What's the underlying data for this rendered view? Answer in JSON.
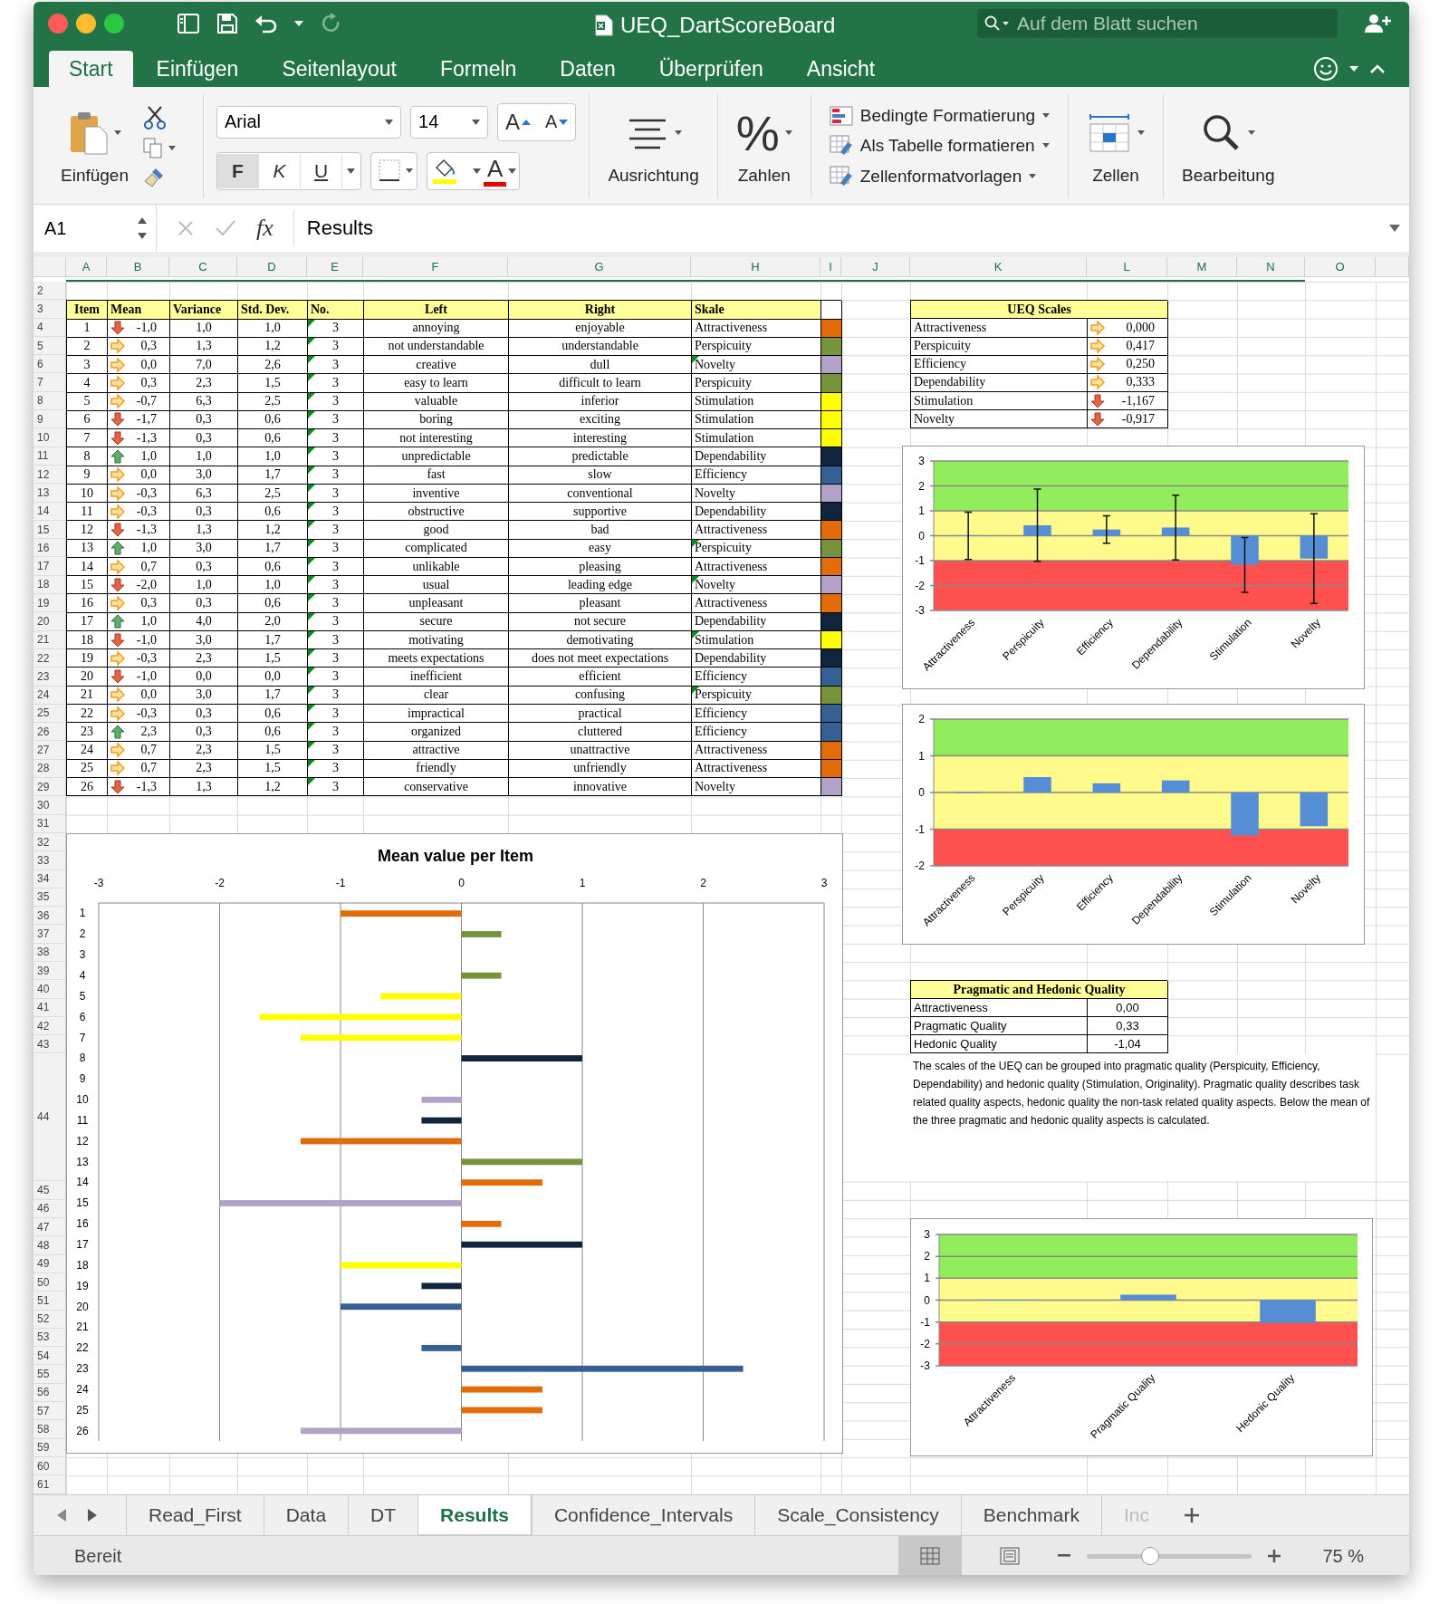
{
  "window": {
    "title": "UEQ_DartScoreBoard"
  },
  "search": {
    "placeholder": "Auf dem Blatt suchen"
  },
  "ribbon_tabs": [
    {
      "label": "Start",
      "selected": true
    },
    {
      "label": "Einfügen",
      "selected": false
    },
    {
      "label": "Seitenlayout",
      "selected": false
    },
    {
      "label": "Formeln",
      "selected": false
    },
    {
      "label": "Daten",
      "selected": false
    },
    {
      "label": "Überprüfen",
      "selected": false
    },
    {
      "label": "Ansicht",
      "selected": false
    }
  ],
  "ribbon": {
    "paste": "Einfügen",
    "font_name": "Arial",
    "font_size": "14",
    "grow_font": "A",
    "shrink_font": "A",
    "bold": "F",
    "italic": "K",
    "underline": "U",
    "font_color": "A",
    "alignment": "Ausrichtung",
    "percent": "%",
    "number": "Zahlen",
    "styles": [
      "Bedingte Formatierung",
      "Als Tabelle formatieren",
      "Zellenformatvorlagen"
    ],
    "cells": "Zellen",
    "editing": "Bearbeitung"
  },
  "formula_bar": {
    "name_box": "A1",
    "fx": "fx",
    "value": "Results"
  },
  "columns": [
    "A",
    "B",
    "C",
    "D",
    "E",
    "F",
    "G",
    "H",
    "I",
    "J",
    "K",
    "L",
    "M",
    "N",
    "O"
  ],
  "rows": [
    "2",
    "3",
    "4",
    "5",
    "6",
    "7",
    "8",
    "9",
    "10",
    "11",
    "12",
    "13",
    "14",
    "15",
    "16",
    "17",
    "18",
    "19",
    "20",
    "21",
    "22",
    "23",
    "24",
    "25",
    "26",
    "27",
    "28",
    "29",
    "30",
    "31",
    "32",
    "33",
    "34",
    "35",
    "36",
    "37",
    "38",
    "39",
    "40",
    "41",
    "42",
    "43",
    "44",
    "45",
    "46",
    "47",
    "48",
    "49",
    "50",
    "51",
    "52",
    "53",
    "54",
    "55",
    "56",
    "57",
    "58",
    "59",
    "60",
    "61"
  ],
  "item_table": {
    "headers": [
      "Item",
      "Mean",
      "Variance",
      "Std. Dev.",
      "No.",
      "Left",
      "Right",
      "Skale"
    ],
    "no_flagged": true,
    "rows": [
      {
        "item": "1",
        "kind": "down",
        "mean": "-1,0",
        "variance": "1,0",
        "std_dev": "1,0",
        "no": "3",
        "left": "annoying",
        "right": "enjoyable",
        "scale": "Attractiveness",
        "scale_flagged": false,
        "color": "#e36c0a"
      },
      {
        "item": "2",
        "kind": "right",
        "mean": "0,3",
        "variance": "1,3",
        "std_dev": "1,2",
        "no": "3",
        "left": "not understandable",
        "right": "understandable",
        "scale": "Perspicuity",
        "scale_flagged": false,
        "color": "#77933c"
      },
      {
        "item": "3",
        "kind": "right",
        "mean": "0,0",
        "variance": "7,0",
        "std_dev": "2,6",
        "no": "3",
        "left": "creative",
        "right": "dull",
        "scale": "Novelty",
        "scale_flagged": true,
        "color": "#b3a2c7"
      },
      {
        "item": "4",
        "kind": "right",
        "mean": "0,3",
        "variance": "2,3",
        "std_dev": "1,5",
        "no": "3",
        "left": "easy to learn",
        "right": "difficult to learn",
        "scale": "Perspicuity",
        "scale_flagged": false,
        "color": "#77933c"
      },
      {
        "item": "5",
        "kind": "right",
        "mean": "-0,7",
        "variance": "6,3",
        "std_dev": "2,5",
        "no": "3",
        "left": "valuable",
        "right": "inferior",
        "scale": "Stimulation",
        "scale_flagged": false,
        "color": "#ffff00"
      },
      {
        "item": "6",
        "kind": "down",
        "mean": "-1,7",
        "variance": "0,3",
        "std_dev": "0,6",
        "no": "3",
        "left": "boring",
        "right": "exciting",
        "scale": "Stimulation",
        "scale_flagged": false,
        "color": "#ffff00"
      },
      {
        "item": "7",
        "kind": "down",
        "mean": "-1,3",
        "variance": "0,3",
        "std_dev": "0,6",
        "no": "3",
        "left": "not interesting",
        "right": "interesting",
        "scale": "Stimulation",
        "scale_flagged": false,
        "color": "#ffff00"
      },
      {
        "item": "8",
        "kind": "up",
        "mean": "1,0",
        "variance": "1,0",
        "std_dev": "1,0",
        "no": "3",
        "left": "unpredictable",
        "right": "predictable",
        "scale": "Dependability",
        "scale_flagged": false,
        "color": "#10243e"
      },
      {
        "item": "9",
        "kind": "right",
        "mean": "0,0",
        "variance": "3,0",
        "std_dev": "1,7",
        "no": "3",
        "left": "fast",
        "right": "slow",
        "scale": "Efficiency",
        "scale_flagged": false,
        "color": "#366092"
      },
      {
        "item": "10",
        "kind": "right",
        "mean": "-0,3",
        "variance": "6,3",
        "std_dev": "2,5",
        "no": "3",
        "left": "inventive",
        "right": "conventional",
        "scale": "Novelty",
        "scale_flagged": false,
        "color": "#b3a2c7"
      },
      {
        "item": "11",
        "kind": "right",
        "mean": "-0,3",
        "variance": "0,3",
        "std_dev": "0,6",
        "no": "3",
        "left": "obstructive",
        "right": "supportive",
        "scale": "Dependability",
        "scale_flagged": false,
        "color": "#10243e"
      },
      {
        "item": "12",
        "kind": "down",
        "mean": "-1,3",
        "variance": "1,3",
        "std_dev": "1,2",
        "no": "3",
        "left": "good",
        "right": "bad",
        "scale": "Attractiveness",
        "scale_flagged": false,
        "color": "#e36c0a"
      },
      {
        "item": "13",
        "kind": "up",
        "mean": "1,0",
        "variance": "3,0",
        "std_dev": "1,7",
        "no": "3",
        "left": "complicated",
        "right": "easy",
        "scale": "Perspicuity",
        "scale_flagged": true,
        "color": "#77933c"
      },
      {
        "item": "14",
        "kind": "right",
        "mean": "0,7",
        "variance": "0,3",
        "std_dev": "0,6",
        "no": "3",
        "left": "unlikable",
        "right": "pleasing",
        "scale": "Attractiveness",
        "scale_flagged": false,
        "color": "#e36c0a"
      },
      {
        "item": "15",
        "kind": "down",
        "mean": "-2,0",
        "variance": "1,0",
        "std_dev": "1,0",
        "no": "3",
        "left": "usual",
        "right": "leading edge",
        "scale": "Novelty",
        "scale_flagged": true,
        "color": "#b3a2c7"
      },
      {
        "item": "16",
        "kind": "right",
        "mean": "0,3",
        "variance": "0,3",
        "std_dev": "0,6",
        "no": "3",
        "left": "unpleasant",
        "right": "pleasant",
        "scale": "Attractiveness",
        "scale_flagged": false,
        "color": "#e36c0a"
      },
      {
        "item": "17",
        "kind": "up",
        "mean": "1,0",
        "variance": "4,0",
        "std_dev": "2,0",
        "no": "3",
        "left": "secure",
        "right": "not secure",
        "scale": "Dependability",
        "scale_flagged": false,
        "color": "#10243e"
      },
      {
        "item": "18",
        "kind": "down",
        "mean": "-1,0",
        "variance": "3,0",
        "std_dev": "1,7",
        "no": "3",
        "left": "motivating",
        "right": "demotivating",
        "scale": "Stimulation",
        "scale_flagged": true,
        "color": "#ffff00"
      },
      {
        "item": "19",
        "kind": "right",
        "mean": "-0,3",
        "variance": "2,3",
        "std_dev": "1,5",
        "no": "3",
        "left": "meets expectations",
        "right": "does not meet expectations",
        "scale": "Dependability",
        "scale_flagged": false,
        "color": "#10243e"
      },
      {
        "item": "20",
        "kind": "down",
        "mean": "-1,0",
        "variance": "0,0",
        "std_dev": "0,0",
        "no": "3",
        "left": "inefficient",
        "right": "efficient",
        "scale": "Efficiency",
        "scale_flagged": false,
        "color": "#366092"
      },
      {
        "item": "21",
        "kind": "right",
        "mean": "0,0",
        "variance": "3,0",
        "std_dev": "1,7",
        "no": "3",
        "left": "clear",
        "right": "confusing",
        "scale": "Perspicuity",
        "scale_flagged": true,
        "color": "#77933c"
      },
      {
        "item": "22",
        "kind": "right",
        "mean": "-0,3",
        "variance": "0,3",
        "std_dev": "0,6",
        "no": "3",
        "left": "impractical",
        "right": "practical",
        "scale": "Efficiency",
        "scale_flagged": false,
        "color": "#366092"
      },
      {
        "item": "23",
        "kind": "up",
        "mean": "2,3",
        "variance": "0,3",
        "std_dev": "0,6",
        "no": "3",
        "left": "organized",
        "right": "cluttered",
        "scale": "Efficiency",
        "scale_flagged": false,
        "color": "#366092"
      },
      {
        "item": "24",
        "kind": "right",
        "mean": "0,7",
        "variance": "2,3",
        "std_dev": "1,5",
        "no": "3",
        "left": "attractive",
        "right": "unattractive",
        "scale": "Attractiveness",
        "scale_flagged": false,
        "color": "#e36c0a"
      },
      {
        "item": "25",
        "kind": "right",
        "mean": "0,7",
        "variance": "2,3",
        "std_dev": "1,5",
        "no": "3",
        "left": "friendly",
        "right": "unfriendly",
        "scale": "Attractiveness",
        "scale_flagged": false,
        "color": "#e36c0a"
      },
      {
        "item": "26",
        "kind": "down",
        "mean": "-1,3",
        "variance": "1,3",
        "std_dev": "1,2",
        "no": "3",
        "left": "conservative",
        "right": "innovative",
        "scale": "Novelty",
        "scale_flagged": false,
        "color": "#b3a2c7"
      }
    ]
  },
  "scales_table": {
    "title": "UEQ Scales",
    "rows": [
      {
        "name": "Attractiveness",
        "kind": "right",
        "value": "0,000"
      },
      {
        "name": "Perspicuity",
        "kind": "right",
        "value": "0,417"
      },
      {
        "name": "Efficiency",
        "kind": "right",
        "value": "0,250"
      },
      {
        "name": "Dependability",
        "kind": "right",
        "value": "0,333"
      },
      {
        "name": "Stimulation",
        "kind": "down",
        "value": "-1,167"
      },
      {
        "name": "Novelty",
        "kind": "down",
        "value": "-0,917"
      }
    ]
  },
  "scale_chart": {
    "chart_data": {
      "type": "bar",
      "categories": [
        "Attractiveness",
        "Perspicuity",
        "Efficiency",
        "Dependability",
        "Stimulation",
        "Novelty"
      ],
      "series": [
        {
          "color": "#558ed5",
          "values": [
            0,
            0.42,
            0.25,
            0.33,
            -1.17,
            -0.92
          ],
          "errors": [
            0.95,
            1.45,
            0.55,
            1.3,
            1.1,
            1.8
          ]
        }
      ],
      "ylim": [
        -3,
        3
      ],
      "yticks": [
        -3,
        -2,
        -1,
        0,
        1,
        2,
        3
      ],
      "grid": true,
      "bands": [
        {
          "axis": "y",
          "from": 1,
          "to": 3,
          "color": "#92ed5c"
        },
        {
          "axis": "y",
          "from": -1,
          "to": 1,
          "color": "#fffa8c"
        },
        {
          "axis": "y",
          "from": -3,
          "to": -1,
          "color": "#ff5050"
        }
      ]
    }
  },
  "scale_chart_plain": {
    "chart_data": {
      "type": "bar",
      "categories": [
        "Attractiveness",
        "Perspicuity",
        "Efficiency",
        "Dependability",
        "Stimulation",
        "Novelty"
      ],
      "series": [
        {
          "color": "#558ed5",
          "values": [
            0,
            0.42,
            0.25,
            0.33,
            -1.17,
            -0.92
          ]
        }
      ],
      "ylim": [
        -2,
        2
      ],
      "yticks": [
        -2,
        -1,
        0,
        1,
        2
      ],
      "grid": true,
      "bands": [
        {
          "axis": "y",
          "from": 1,
          "to": 2,
          "color": "#92ed5c"
        },
        {
          "axis": "y",
          "from": -1,
          "to": 1,
          "color": "#fffa8c"
        },
        {
          "axis": "y",
          "from": -2,
          "to": -1,
          "color": "#ff5050"
        }
      ]
    }
  },
  "quality_table": {
    "title": "Pragmatic and Hedonic Quality",
    "rows": [
      {
        "name": "Attractiveness",
        "value": "0,00"
      },
      {
        "name": "Pragmatic Quality",
        "value": "0,33"
      },
      {
        "name": "Hedonic Quality",
        "value": "-1,04"
      }
    ]
  },
  "quality_note": "The scales of the UEQ can be grouped into pragmatic quality (Perspicuity, Efficiency, Dependability) and hedonic quality (Stimulation, Originality). Pragmatic quality describes task related quality aspects, hedonic quality the non-task related quality aspects. Below the mean of the three pragmatic and hedonic quality aspects is calculated.",
  "quality_chart": {
    "chart_data": {
      "type": "bar",
      "categories": [
        "Attractiveness",
        "Pragmatic Quality",
        "Hedonic Quality"
      ],
      "series": [
        {
          "color": "#558ed5",
          "values": [
            0,
            0.25,
            -1.04
          ]
        }
      ],
      "ylim": [
        -3,
        3
      ],
      "yticks": [
        -3,
        -2,
        -1,
        0,
        1,
        2,
        3
      ],
      "grid": true,
      "bands": [
        {
          "axis": "y",
          "from": 1,
          "to": 3,
          "color": "#92ed5c"
        },
        {
          "axis": "y",
          "from": -1,
          "to": 1,
          "color": "#fffa8c"
        },
        {
          "axis": "y",
          "from": -3,
          "to": -1,
          "color": "#ff5050"
        }
      ]
    }
  },
  "item_chart": {
    "chart_data": {
      "type": "bar",
      "orientation": "horizontal",
      "title": "Mean value per Item",
      "grid": true,
      "categories": [
        "1",
        "2",
        "3",
        "4",
        "5",
        "6",
        "7",
        "8",
        "9",
        "10",
        "11",
        "12",
        "13",
        "14",
        "15",
        "16",
        "17",
        "18",
        "19",
        "20",
        "21",
        "22",
        "23",
        "24",
        "25",
        "26"
      ],
      "xlim": [
        -3,
        3
      ],
      "xticks": [
        -3,
        -2,
        -1,
        0,
        1,
        2,
        3
      ],
      "series": [
        {
          "color": "#e36c0a",
          "values": [
            -1,
            null,
            null,
            null,
            null,
            null,
            null,
            null,
            null,
            null,
            null,
            -1.33,
            null,
            0.67,
            null,
            0.33,
            null,
            null,
            null,
            null,
            null,
            null,
            null,
            0.67,
            0.67,
            null
          ]
        },
        {
          "color": "#77933c",
          "values": [
            null,
            0.33,
            null,
            0.33,
            null,
            null,
            null,
            null,
            null,
            null,
            null,
            null,
            1,
            null,
            null,
            null,
            null,
            null,
            null,
            null,
            0,
            null,
            null,
            null,
            null,
            null
          ]
        },
        {
          "color": "#b3a2c7",
          "values": [
            null,
            null,
            0,
            null,
            null,
            null,
            null,
            null,
            null,
            -0.33,
            null,
            null,
            null,
            null,
            -2,
            null,
            null,
            null,
            null,
            null,
            null,
            null,
            null,
            null,
            null,
            -1.33
          ]
        },
        {
          "color": "#ffff00",
          "values": [
            null,
            null,
            null,
            null,
            -0.67,
            -1.67,
            -1.33,
            null,
            null,
            null,
            null,
            null,
            null,
            null,
            null,
            null,
            null,
            -1,
            null,
            null,
            null,
            null,
            null,
            null,
            null,
            null
          ]
        },
        {
          "color": "#10243e",
          "values": [
            null,
            null,
            null,
            null,
            null,
            null,
            null,
            1,
            null,
            null,
            -0.33,
            null,
            null,
            null,
            null,
            null,
            1,
            null,
            -0.33,
            null,
            null,
            null,
            null,
            null,
            null,
            null
          ]
        },
        {
          "color": "#366092",
          "values": [
            null,
            null,
            null,
            null,
            null,
            null,
            null,
            null,
            0,
            null,
            null,
            null,
            null,
            null,
            null,
            null,
            null,
            null,
            null,
            -1,
            null,
            -0.33,
            2.33,
            null,
            null,
            null
          ]
        }
      ]
    }
  },
  "sheet_tabs": [
    {
      "label": "Read_First",
      "selected": false
    },
    {
      "label": "Data",
      "selected": false
    },
    {
      "label": "DT",
      "selected": false
    },
    {
      "label": "Results",
      "selected": true
    },
    {
      "label": "Confidence_Intervals",
      "selected": false
    },
    {
      "label": "Scale_Consistency",
      "selected": false
    },
    {
      "label": "Benchmark",
      "selected": false
    },
    {
      "label": "Inc",
      "selected": false,
      "cut": true
    }
  ],
  "status_bar": {
    "status": "Bereit",
    "zoom": "75 %",
    "zoom_slider": {
      "level": 0.38
    }
  }
}
